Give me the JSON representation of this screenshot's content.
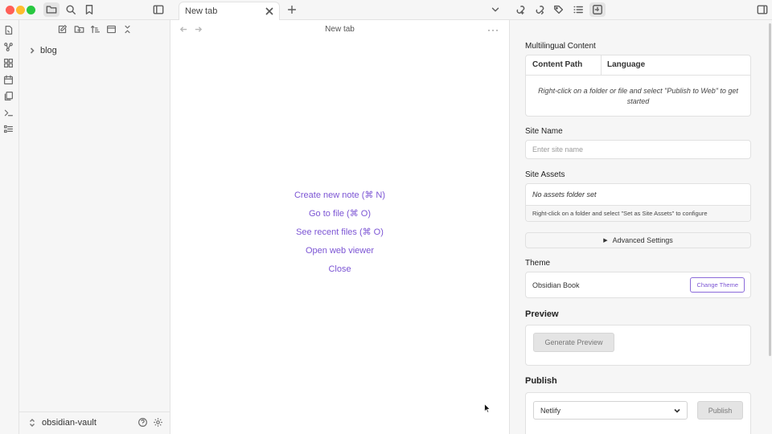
{
  "tabs": [
    {
      "label": "New tab",
      "active": true
    }
  ],
  "sidebar": {
    "tree": [
      {
        "type": "folder",
        "label": "blog",
        "collapsed": true
      }
    ],
    "vault_name": "obsidian-vault"
  },
  "main": {
    "view_title": "New tab",
    "more_menu": "···",
    "actions": [
      {
        "label": "Create new note (⌘ N)"
      },
      {
        "label": "Go to file (⌘ O)"
      },
      {
        "label": "See recent files (⌘ O)"
      },
      {
        "label": "Open web viewer"
      },
      {
        "label": "Close"
      }
    ]
  },
  "publish_panel": {
    "multilingual": {
      "title": "Multilingual Content",
      "columns": [
        "Content Path",
        "Language"
      ],
      "empty_text": "Right-click on a folder or file and select \"Publish to Web\" to get started"
    },
    "site_name": {
      "label": "Site Name",
      "placeholder": "Enter site name",
      "value": ""
    },
    "site_assets": {
      "label": "Site Assets",
      "empty_text": "No assets folder set",
      "hint": "Right-click on a folder and select \"Set as Site Assets\" to configure"
    },
    "advanced": {
      "label": "Advanced Settings",
      "expanded": false
    },
    "theme": {
      "label": "Theme",
      "current": "Obsidian Book",
      "change_label": "Change Theme"
    },
    "preview": {
      "heading": "Preview",
      "button_label": "Generate Preview"
    },
    "publish": {
      "heading": "Publish",
      "provider": "Netlify",
      "button_label": "Publish"
    }
  },
  "colors": {
    "accent": "#7c55d4",
    "chrome_bg": "#f6f6f6",
    "border": "#e3e3e3",
    "traffic_close": "#ff5f57",
    "traffic_min": "#febc2e",
    "traffic_max": "#28c840"
  },
  "icons": {
    "titlebar_left": [
      "files-icon",
      "search-icon",
      "bookmark-icon",
      "sidebar-toggle-icon"
    ],
    "titlebar_right": [
      "backlinks-icon",
      "outgoing-links-icon",
      "tags-icon",
      "outline-icon",
      "publish-icon",
      "right-sidebar-toggle-icon"
    ],
    "ribbon": [
      "open-quick-switcher-icon",
      "graph-view-icon",
      "canvas-icon",
      "daily-note-icon",
      "templates-icon",
      "command-palette-icon",
      "bases-icon"
    ],
    "file_tools": [
      "new-note-icon",
      "new-folder-icon",
      "sort-icon",
      "collapse-all-icon",
      "expand-icon"
    ]
  }
}
